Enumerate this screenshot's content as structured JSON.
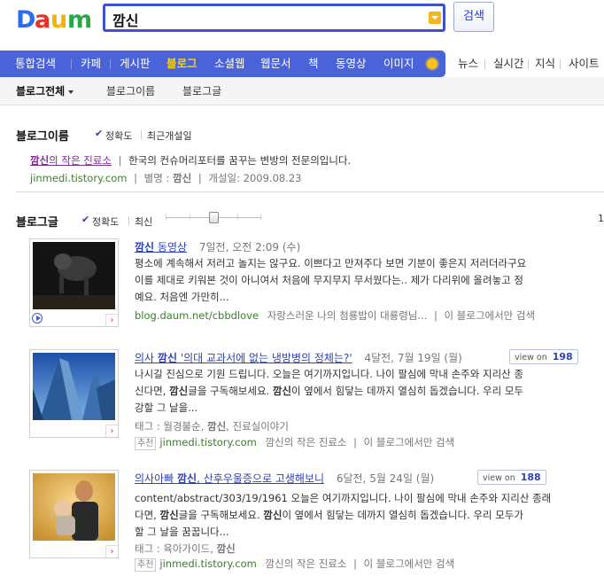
{
  "header": {
    "logo_text": "DAUM",
    "search_value": "깜신",
    "search_button": "검색"
  },
  "nav": {
    "items": [
      "통합검색",
      "카페",
      "게시판",
      "블로그",
      "소셜웹",
      "웹문서",
      "책",
      "동영상",
      "이미지"
    ],
    "extra": [
      "뉴스",
      "실시간",
      "지식",
      "사이트"
    ]
  },
  "subnav": {
    "items": [
      "블로그전체",
      "블로그이름",
      "블로그글"
    ]
  },
  "blog_name_section": {
    "title": "블로그이름",
    "sort_accuracy": "정확도",
    "sort_recent": "최근개설일",
    "result": {
      "name_kw": "깜신",
      "name_rest": "의 작은 진료소",
      "desc": "한국의 컨슈머리포터를 꿈꾸는 변방의 전문의입니다.",
      "url": "jinmedi.tistory.com",
      "nick_label": "별명 :",
      "nick": "깜신",
      "opened": "개설일: 2009.08.23"
    }
  },
  "blog_post_section": {
    "title": "블로그글",
    "sort_accuracy": "정확도",
    "sort_recent": "최신",
    "edge_number": "1"
  },
  "results": [
    {
      "title_kw": "깜신",
      "title_rest": " 동영상",
      "date": "7일전, 오전 2:09 (수)",
      "lines": [
        "평소에 계속해서 저러고 놀지는 않구요. 이쁘다고 만져주다 보면 기분이 좋은지 저러더라구요",
        "이를 제대로 키워본 것이 아니여서 처음에 무지무지 무서웠다는.. 제가 다리위에 올려놓고 정",
        "예요. 처음엔 가만히..."
      ],
      "url": "blog.daum.net/cbbdlove",
      "blog_name": "자랑스러운 나의 첨룡밥이 대룡령님...",
      "only_this": "이 블로그에서만 검색"
    },
    {
      "title_pre": "의사 ",
      "title_kw": "깜신",
      "title_rest": " '의대 교과서에 없는 냉방병의 정체는?'",
      "date": "4달전, 7월 19일 (월)",
      "viewon_label": "view on",
      "viewon_count": "198",
      "lines": [
        "나시길 진심으로 기원 드립니다. 오늘은 여기까지입니다. 나이 팔심에 막내 손주와 지리산 종",
        "신다면, ",
        "강할 그 날을..."
      ],
      "line2_kw1": "깜신",
      "line2_mid": "글을 구독해보세요. ",
      "line2_kw2": "깜신",
      "line2_rest": "이 옆에서 힘닿는 데까지 열심히 돕겠습니다. 우리 모두",
      "tags_label": "태그 : ",
      "tags": "월경불순, ",
      "tags_kw": "깜신",
      "tags_rest": ", 진료실이야기",
      "rec": "추천",
      "url": "jinmedi.tistory.com",
      "blog_name": "깜신의 작은 진료소",
      "only_this": "이 블로그에서만 검색"
    },
    {
      "title_pre": "의사아빠 ",
      "title_kw": "깜신",
      "title_rest": ", 산후우울증으로 고생해보니",
      "date": "6달전, 5월 24일 (월)",
      "viewon_label": "view on",
      "viewon_count": "188",
      "lines": [
        "content/abstract/303/19/1961 오늘은 여기까지입니다. 나이 팔심에 막내 손주와 지리산 종래",
        "다면, ",
        "할 그 날을 꿈꿉니다..."
      ],
      "line2_kw1": "깜신",
      "line2_mid": "글을 구독해보세요. ",
      "line2_kw2": "깜신",
      "line2_rest": "이 옆에서 힘닿는 데까지 열심히 돕겠습니다. 우리 모두가",
      "tags_label": "태그 : ",
      "tags": "육아가이드, ",
      "tags_kw": "깜신",
      "tags_rest": "",
      "rec": "추천",
      "url": "jinmedi.tistory.com",
      "blog_name": "깜신의 작은 진료소",
      "only_this": "이 블로그에서만 검색"
    }
  ],
  "colors": {
    "nav_bg": "#4a63d8",
    "nav_active": "#ffd400",
    "link_blue": "#2d42b5",
    "url_green": "#3a7f2c"
  }
}
